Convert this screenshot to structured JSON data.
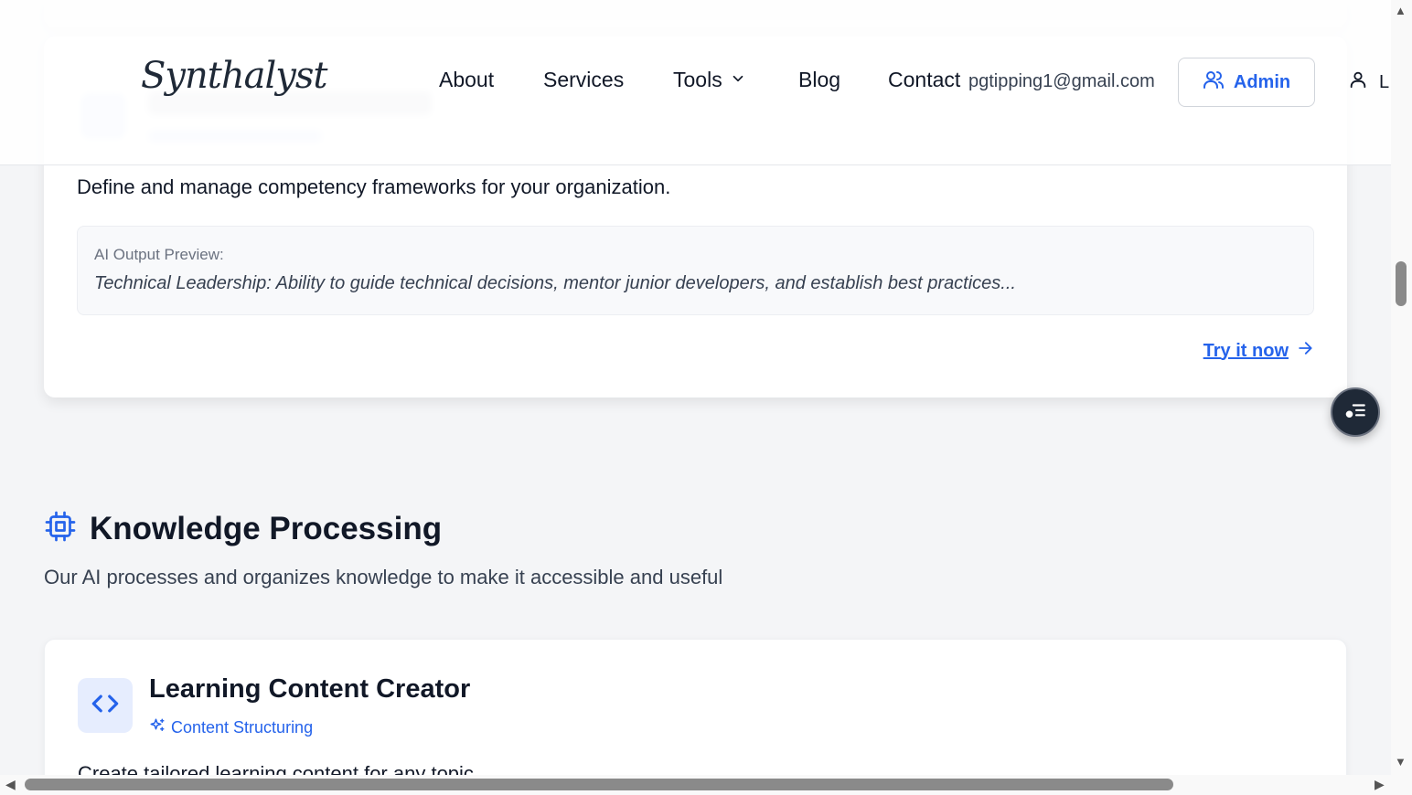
{
  "header": {
    "logo_text": "Synthalyst",
    "nav": {
      "about": "About",
      "services": "Services",
      "tools": "Tools",
      "blog": "Blog",
      "contact": "Contact"
    },
    "email": "pgtipping1@gmail.com",
    "admin_label": "Admin",
    "user_initial": "L"
  },
  "card_competency": {
    "description": "Define and manage competency frameworks for your organization.",
    "preview_label": "AI Output Preview:",
    "preview_text": "Technical Leadership: Ability to guide technical decisions, mentor junior developers, and establish best practices...",
    "cta": "Try it now"
  },
  "section": {
    "title": "Knowledge Processing",
    "subtitle": "Our AI processes and organizes knowledge to make it accessible and useful"
  },
  "card_learning": {
    "title": "Learning Content Creator",
    "tag": "Content Structuring",
    "description": "Create tailored learning content for any topic"
  },
  "icons": {
    "tools_chevron": "chevron-down-icon",
    "admin": "users-icon",
    "user": "user-icon",
    "cta_arrow": "arrow-right-icon",
    "section": "cpu-icon",
    "card": "code-icon",
    "tag": "sparkles-icon",
    "fab": "list-icon"
  },
  "colors": {
    "accent": "#2563eb",
    "background": "#f4f5f7",
    "card": "#ffffff"
  }
}
